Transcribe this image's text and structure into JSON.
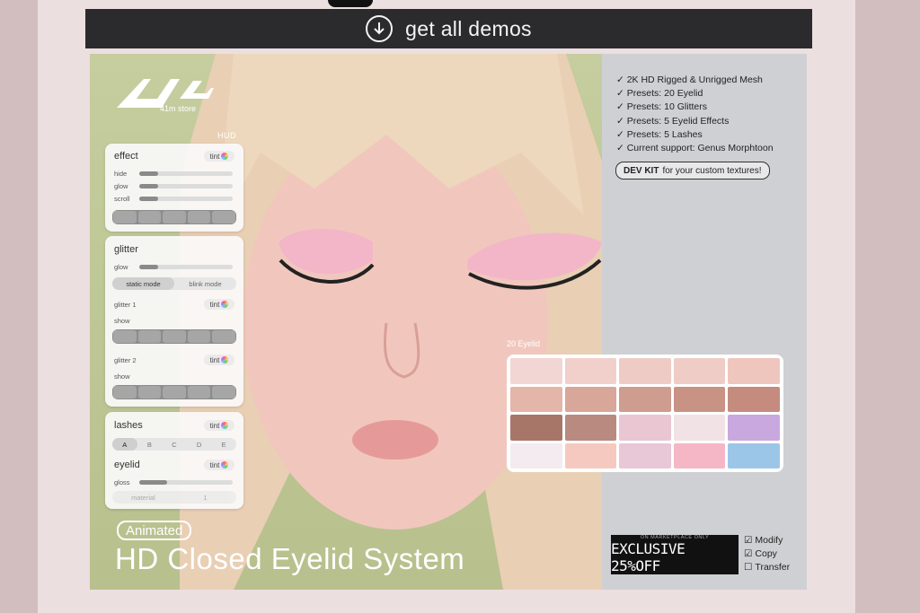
{
  "banner": {
    "label": "get all demos",
    "icon": "download-circle-icon"
  },
  "logo": {
    "store_name": "41m store"
  },
  "hud": {
    "title": "HUD",
    "tint_label": "tint",
    "effect": {
      "title": "effect",
      "rows": [
        "hide",
        "glow",
        "scroll"
      ],
      "levels": [
        0.2,
        0.2,
        0.2
      ]
    },
    "glitter": {
      "title": "glitter",
      "glow_label": "glow",
      "glow_level": 0.2,
      "modes": [
        "static mode",
        "blink mode"
      ],
      "glitter1": "glitter 1",
      "glitter2": "glitter 2",
      "show_label": "show"
    },
    "lashes": {
      "title": "lashes",
      "options": [
        "A",
        "B",
        "C",
        "D",
        "E"
      ]
    },
    "eyelid": {
      "title": "eyelid",
      "gloss_label": "gloss",
      "gloss_level": 0.3,
      "sub": [
        "material",
        "1"
      ]
    }
  },
  "swatches": {
    "label": "20 Eyelid",
    "colors": [
      "#f2d6d3",
      "#f1d0cc",
      "#efcbc5",
      "#f0ccc6",
      "#efc6be",
      "#e4b5a9",
      "#d9a69a",
      "#cf9c90",
      "#c89284",
      "#c48b7e",
      "#a77669",
      "#b88a80",
      "#e9c6d2",
      "#f1e2e6",
      "#c9a7df",
      "#f3ebf0",
      "#f6c9c0",
      "#e8c7d6",
      "#f5b7c6",
      "#9cc6e8"
    ]
  },
  "features": [
    "✓ 2K HD Rigged & Unrigged Mesh",
    "✓ Presets: 20 Eyelid",
    "✓ Presets: 10 Glitters",
    "✓ Presets: 5 Eyelid Effects",
    "✓ Presets: 5 Lashes",
    "✓ Current support: Genus Morphtoon"
  ],
  "devkit": {
    "bold": "DEV KIT",
    "text": "for your custom textures!"
  },
  "product": {
    "badge": "Animated",
    "title": "HD Closed Eyelid System"
  },
  "promo": {
    "small": "ON MARKETPLACE ONLY",
    "big": "EXCLUSIVE 25%OFF"
  },
  "permissions": [
    {
      "label": "Modify",
      "checked": "☑"
    },
    {
      "label": "Copy",
      "checked": "☑"
    },
    {
      "label": "Transfer",
      "checked": "☐"
    }
  ]
}
